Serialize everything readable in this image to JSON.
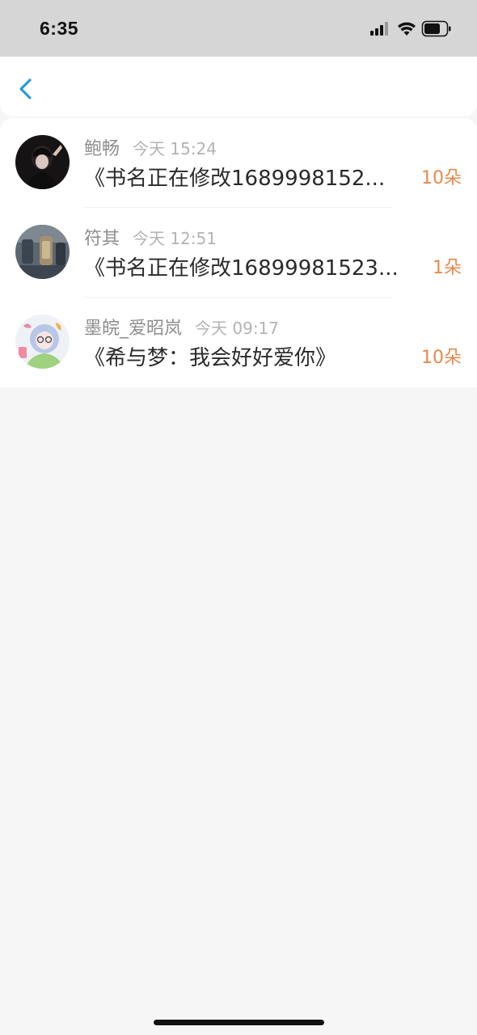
{
  "status_bar": {
    "time": "6:35",
    "icons": [
      "signal-icon",
      "wifi-icon",
      "battery-icon"
    ]
  },
  "nav": {
    "back_icon": "chevron-left-icon",
    "accent_color": "#2a9bd8"
  },
  "list": {
    "items": [
      {
        "name": "鲍畅",
        "time": "今天 15:24",
        "book": "《书名正在修改1689998152...",
        "count": "10朵"
      },
      {
        "name": "符其",
        "time": "今天 12:51",
        "book": "《书名正在修改16899981523...",
        "count": "1朵"
      },
      {
        "name": "墨皖_爱昭岚",
        "time": "今天 09:17",
        "book": "《希与梦：我会好好爱你》",
        "count": "10朵"
      }
    ]
  },
  "colors": {
    "count_color": "#e8884b",
    "background": "#f6f6f6"
  }
}
